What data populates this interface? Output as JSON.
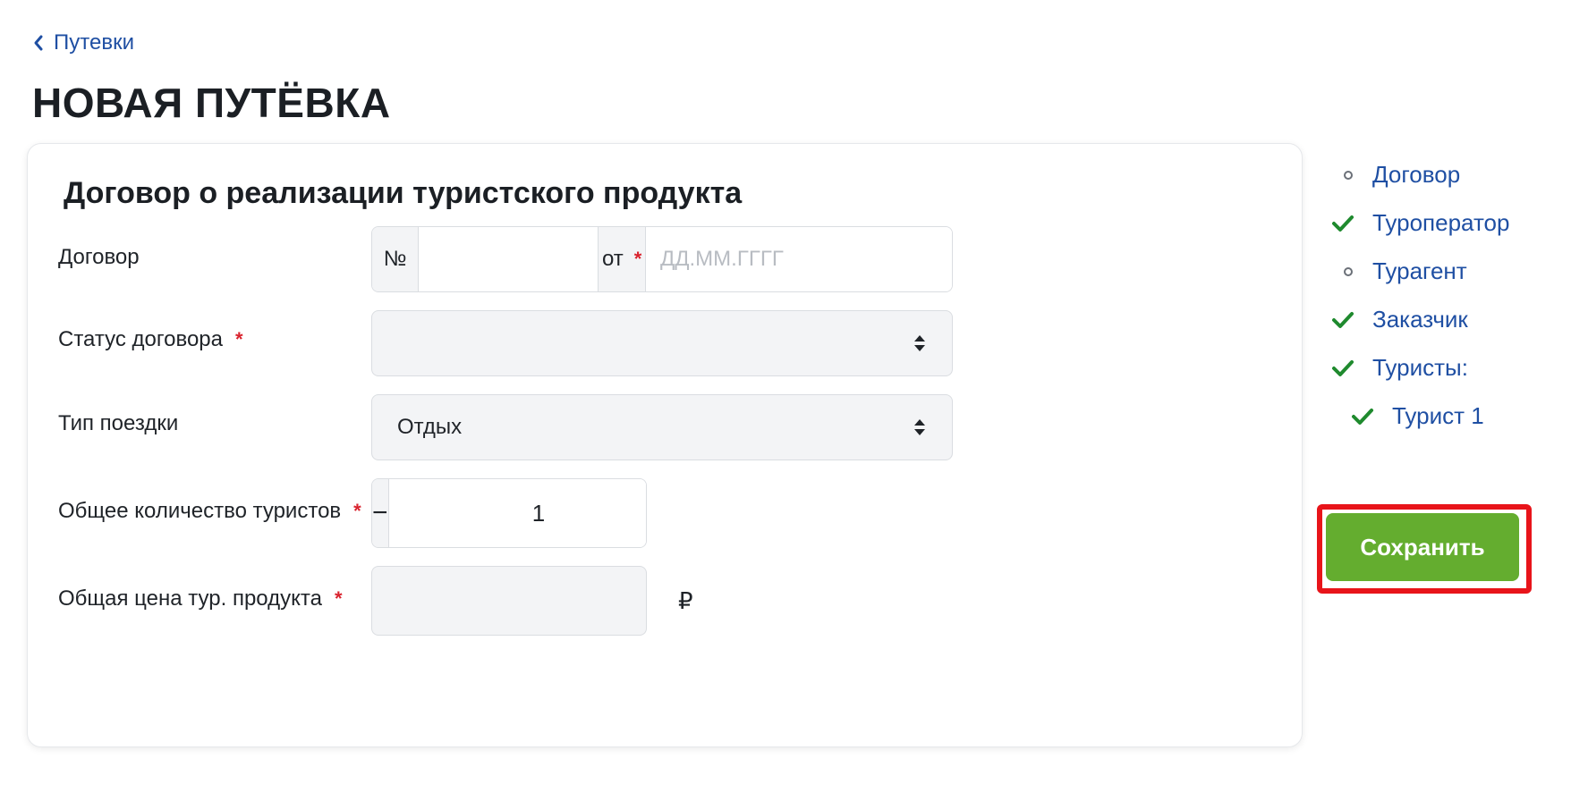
{
  "breadcrumb": {
    "back_label": "Путевки"
  },
  "page": {
    "title": "НОВАЯ ПУТЁВКА"
  },
  "form": {
    "title": "Договор о реализации туристского продукта",
    "contract": {
      "label": "Договор",
      "number_prefix": "№",
      "number_value": "",
      "date_prefix": "от",
      "date_placeholder": "ДД.ММ.ГГГГ",
      "required_mark": "*"
    },
    "status": {
      "label": "Статус договора",
      "required_mark": "*",
      "value": ""
    },
    "trip_type": {
      "label": "Тип поездки",
      "value": "Отдых"
    },
    "tourists_count": {
      "label": "Общее количество туристов",
      "required_mark": "*",
      "value": "1",
      "minus": "−",
      "plus": "+"
    },
    "price": {
      "label": "Общая цена тур. продукта",
      "required_mark": "*",
      "value": "",
      "currency": "₽"
    }
  },
  "side_nav": {
    "items": [
      {
        "label": "Договор",
        "status": "pending",
        "icon": "circle-icon"
      },
      {
        "label": "Туроператор",
        "status": "done",
        "icon": "check-icon"
      },
      {
        "label": "Турагент",
        "status": "pending",
        "icon": "circle-icon"
      },
      {
        "label": "Заказчик",
        "status": "done",
        "icon": "check-icon"
      },
      {
        "label": "Туристы:",
        "status": "done",
        "icon": "check-icon"
      },
      {
        "label": "Турист 1",
        "status": "done",
        "icon": "check-icon"
      }
    ]
  },
  "actions": {
    "save_label": "Сохранить"
  },
  "colors": {
    "link": "#1f4fa3",
    "save_button": "#64ad2f",
    "check": "#1f8a2e",
    "required": "#d9232e",
    "highlight_outline": "#e8141a"
  }
}
